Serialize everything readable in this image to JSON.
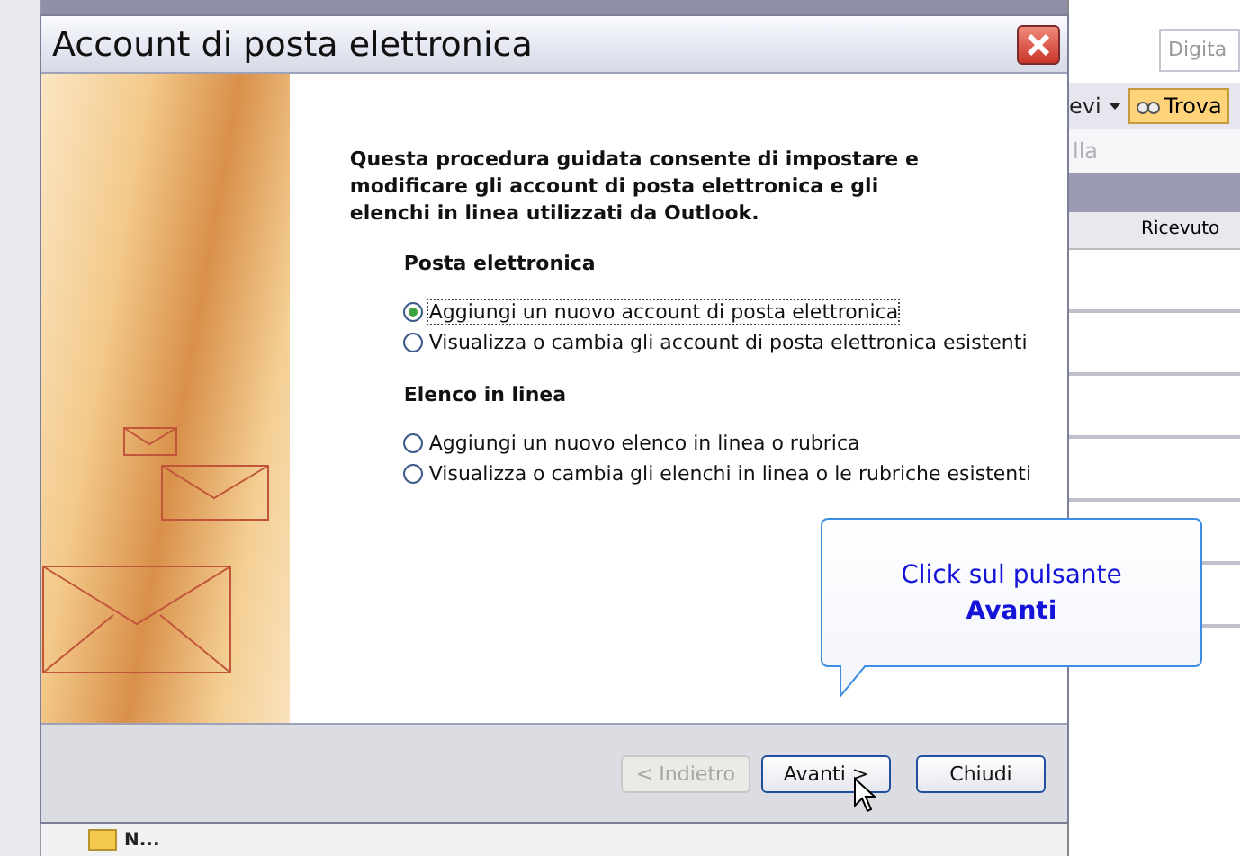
{
  "background": {
    "search_placeholder": "Digita",
    "toolbar_item": "evi",
    "find_button": "Trova",
    "dimmed_text": "lla",
    "column_header": "Ricevuto",
    "folder_label": "N..."
  },
  "dialog": {
    "title": "Account di posta elettronica",
    "intro": "Questa procedura guidata consente di impostare e modificare gli account di posta elettronica e gli elenchi in linea utilizzati da Outlook.",
    "sections": [
      {
        "heading": "Posta elettronica",
        "options": [
          {
            "label": "Aggiungi un nuovo account di posta elettronica",
            "selected": true
          },
          {
            "label": "Visualizza o cambia gli account di posta elettronica esistenti",
            "selected": false
          }
        ]
      },
      {
        "heading": "Elenco in linea",
        "options": [
          {
            "label": "Aggiungi un nuovo elenco in linea o rubrica",
            "selected": false
          },
          {
            "label": "Visualizza o cambia gli elenchi in linea o le rubriche esistenti",
            "selected": false
          }
        ]
      }
    ],
    "buttons": [
      {
        "label": "< Indietro",
        "disabled": true
      },
      {
        "label": "Avanti >",
        "disabled": false
      },
      {
        "label": "Chiudi",
        "disabled": false
      }
    ]
  },
  "callout": {
    "text": "Click sul pulsante",
    "emphasis": "Avanti"
  }
}
